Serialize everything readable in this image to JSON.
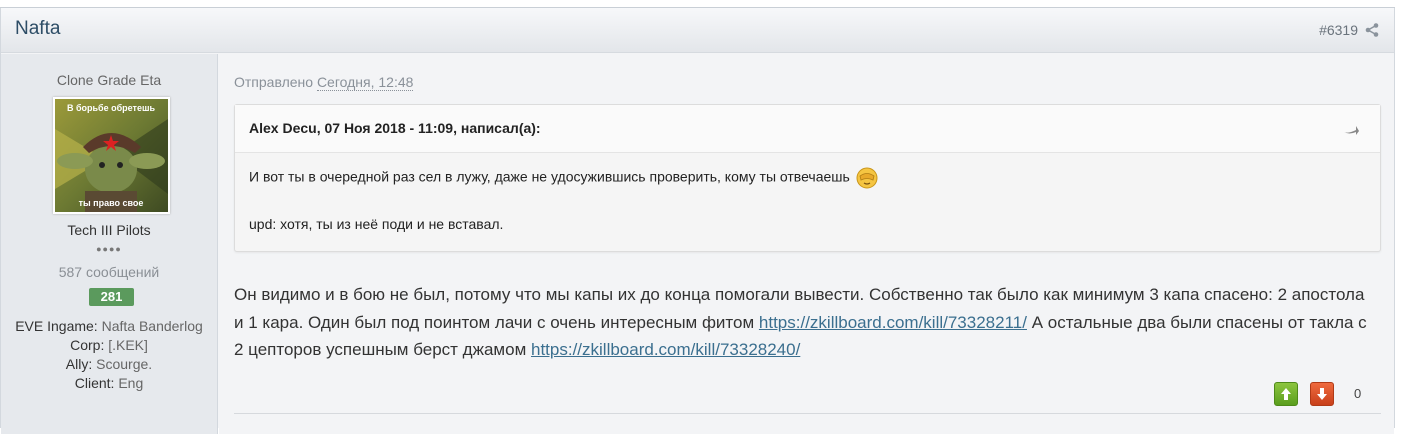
{
  "post": {
    "author": "Nafta",
    "number": "#6319",
    "icons": {
      "share": "share-icon",
      "quote_back": "quote-back-arrow-icon",
      "vote_up": "arrow-up-icon",
      "vote_down": "arrow-down-icon",
      "facepalm": "facepalm-emoji-icon"
    }
  },
  "sidebar": {
    "grade": "Clone Grade Eta",
    "avatar_text_top": "В борьбе обретешь",
    "avatar_text_bottom": "ты право свое",
    "group": "Tech III Pilots",
    "pips": "●●●●",
    "message_count": "587 сообщений",
    "reputation": "281",
    "reputation_color": "#5b9a5d",
    "fields": [
      {
        "key": "EVE Ingame:",
        "value": "Nafta Banderlog"
      },
      {
        "key": "Corp:",
        "value": "[.KEK]"
      },
      {
        "key": "Ally:",
        "value": "Scourge."
      },
      {
        "key": "Client:",
        "value": "Eng"
      }
    ]
  },
  "content": {
    "posted_label": "Отправлено",
    "posted_date": "Сегодня, 12:48",
    "quote": {
      "header": "Alex Decu, 07 Ноя 2018 - 11:09, написал(а):",
      "line1": "И вот ты в очередной раз сел в лужу, даже не удосужившись проверить, кому ты отвечаешь",
      "line2": "upd: хотя, ты из неё поди и не вставал."
    },
    "body_part1": "Он видимо и в бою не был, потому что мы капы их до конца помогали вывести. Собственно так было как минимум 3 капа спасено: 2 апостола и 1 кара. Один был под поинтом лачи с очень интересным фитом ",
    "link1": "https://zkillboard.com/kill/73328211/",
    "body_part2": " А остальные два были спасены от такла с 2 цепторов успешным берст джамом ",
    "link2": "https://zkillboard.com/kill/73328240/",
    "vote_count": "0"
  }
}
